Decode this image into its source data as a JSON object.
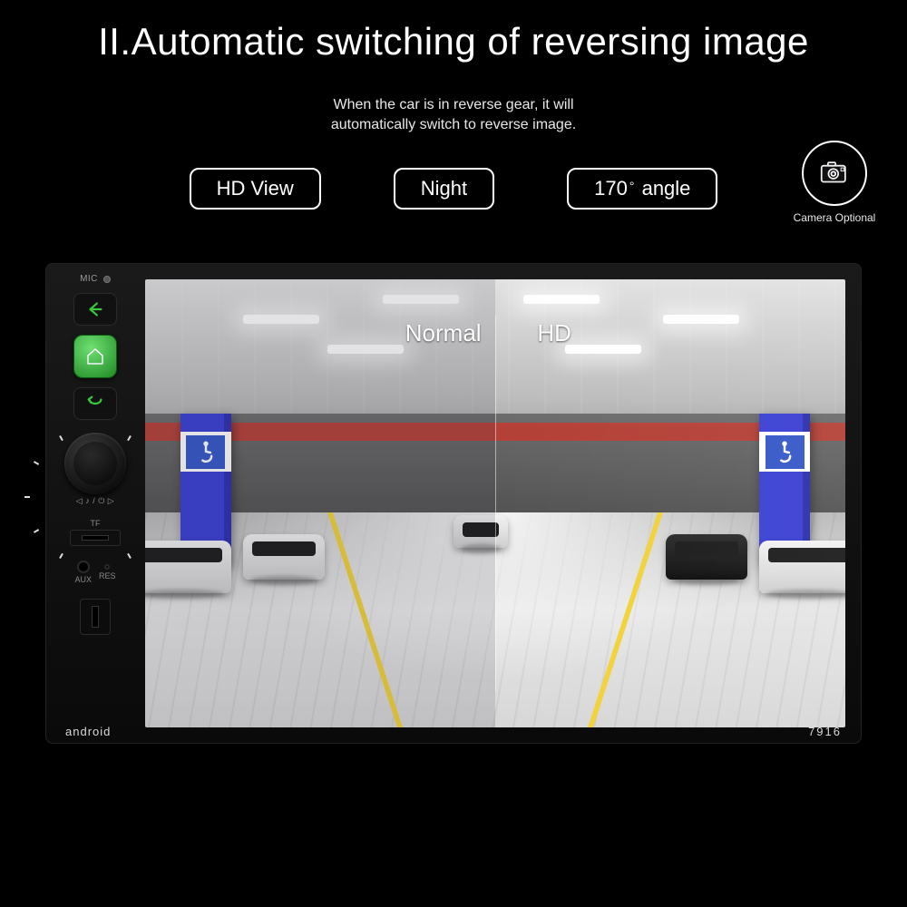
{
  "title": "II.Automatic switching of reversing image",
  "subtitle_l1": "When the car is in reverse gear, it will",
  "subtitle_l2": "automatically switch to reverse image.",
  "badges": {
    "hd": "HD View",
    "night": "Night",
    "angle_num": "170",
    "angle_word": "angle"
  },
  "camera_caption": "Camera Optional",
  "device": {
    "mic": "MIC",
    "knob_sub": "◁ ♪ / ⏻ ▷",
    "tf": "TF",
    "aux": "AUX",
    "res": "RES",
    "brand": "android",
    "model": "7916"
  },
  "screen": {
    "normal": "Normal",
    "hd": "HD"
  }
}
